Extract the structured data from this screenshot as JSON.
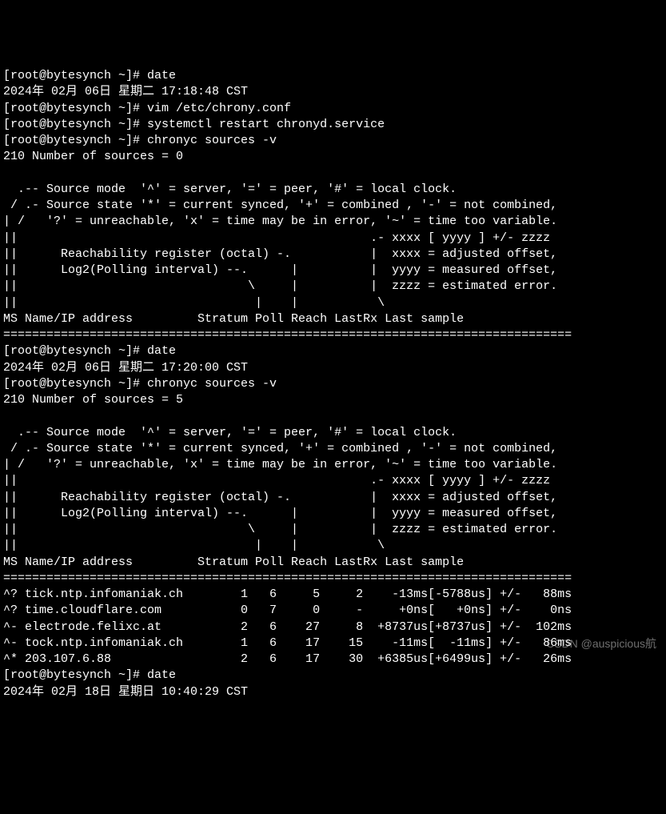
{
  "prompt": "[root@bytesynch ~]# ",
  "commands": {
    "date1": "date",
    "date1_output": "2024年 02月 06日 星期二 17:18:48 CST",
    "vim": "vim /etc/chrony.conf",
    "restart": "systemctl restart chronyd.service",
    "sources1": "chronyc sources -v",
    "sources1_count": "210 Number of sources = 0",
    "date2": "date",
    "date2_output": "2024年 02月 06日 星期二 17:20:00 CST",
    "sources2": "chronyc sources -v",
    "sources2_count": "210 Number of sources = 5",
    "date3": "date",
    "date3_output": "2024年 02月 18日 星期日 10:40:29 CST"
  },
  "legend": {
    "l1": "  .-- Source mode  '^' = server, '=' = peer, '#' = local clock.",
    "l2": " / .- Source state '*' = current synced, '+' = combined , '-' = not combined,",
    "l3": "| /   '?' = unreachable, 'x' = time may be in error, '~' = time too variable.",
    "l4": "||                                                 .- xxxx [ yyyy ] +/- zzzz",
    "l5": "||      Reachability register (octal) -.           |  xxxx = adjusted offset,",
    "l6": "||      Log2(Polling interval) --.      |          |  yyyy = measured offset,",
    "l7": "||                                \\     |          |  zzzz = estimated error.",
    "l8": "||                                 |    |           \\",
    "header": "MS Name/IP address         Stratum Poll Reach LastRx Last sample"
  },
  "separator": "===============================================================================",
  "blank": "",
  "chart_data": {
    "type": "table",
    "columns": [
      "MS",
      "Name/IP address",
      "Stratum",
      "Poll",
      "Reach",
      "LastRx",
      "Last sample"
    ],
    "rows": [
      {
        "ms": "^?",
        "name": "tick.ntp.infomaniak.ch",
        "stratum": 1,
        "poll": 6,
        "reach": 5,
        "lastrx": "2",
        "sample": "-13ms[-5788us] +/-   88ms"
      },
      {
        "ms": "^?",
        "name": "time.cloudflare.com",
        "stratum": 0,
        "poll": 7,
        "reach": 0,
        "lastrx": "-",
        "sample": "+0ns[   +0ns] +/-    0ns"
      },
      {
        "ms": "^-",
        "name": "electrode.felixc.at",
        "stratum": 2,
        "poll": 6,
        "reach": 27,
        "lastrx": "8",
        "sample": "+8737us[+8737us] +/-  102ms"
      },
      {
        "ms": "^-",
        "name": "tock.ntp.infomaniak.ch",
        "stratum": 1,
        "poll": 6,
        "reach": 17,
        "lastrx": "15",
        "sample": "-11ms[  -11ms] +/-   86ms"
      },
      {
        "ms": "^*",
        "name": "203.107.6.88",
        "stratum": 2,
        "poll": 6,
        "reach": 17,
        "lastrx": "30",
        "sample": "+6385us[+6499us] +/-   26ms"
      }
    ]
  },
  "table_lines": {
    "r0": "^? tick.ntp.infomaniak.ch        1   6     5     2    -13ms[-5788us] +/-   88ms",
    "r1": "^? time.cloudflare.com           0   7     0     -     +0ns[   +0ns] +/-    0ns",
    "r2": "^- electrode.felixc.at           2   6    27     8  +8737us[+8737us] +/-  102ms",
    "r3": "^- tock.ntp.infomaniak.ch        1   6    17    15    -11ms[  -11ms] +/-   86ms",
    "r4": "^* 203.107.6.88                  2   6    17    30  +6385us[+6499us] +/-   26ms"
  },
  "watermark": "CSDN @auspicious航"
}
